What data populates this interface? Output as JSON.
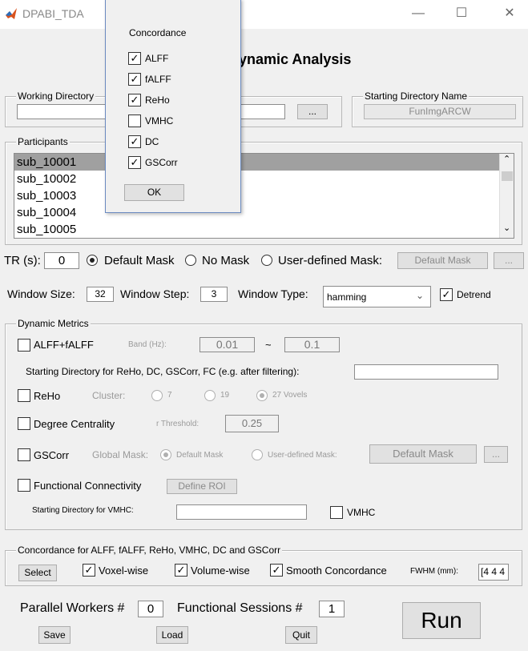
{
  "window": {
    "title": "DPABI_TDA",
    "minimize_glyph": "—",
    "maximize_glyph": "☐",
    "close_glyph": "✕"
  },
  "heading": "ynamic Analysis",
  "working_dir": {
    "legend": "Working Directory",
    "value": "",
    "browse_label": "..."
  },
  "starting_dir": {
    "legend": "Starting Directory Name",
    "value": "FunImgARCW"
  },
  "participants": {
    "legend": "Participants",
    "items": [
      "sub_10001",
      "sub_10002",
      "sub_10003",
      "sub_10004",
      "sub_10005"
    ]
  },
  "mask_row": {
    "tr_label": "TR (s):",
    "tr_value": "0",
    "default_mask": "Default Mask",
    "no_mask": "No Mask",
    "user_mask": "User-defined Mask:",
    "mask_button": "Default Mask",
    "browse_label": "...",
    "selected": "default"
  },
  "window_row": {
    "size_label": "Window Size:",
    "size_value": "32",
    "step_label": "Window Step:",
    "step_value": "3",
    "type_label": "Window Type:",
    "type_value": "hamming",
    "detrend_label": "Detrend",
    "detrend_checked": true
  },
  "dynamic_metrics": {
    "legend": "Dynamic Metrics",
    "alff_label": "ALFF+fALFF",
    "band_label": "Band (Hz):",
    "band_low": "0.01",
    "tilde": "~",
    "band_high": "0.1",
    "starting_dir_label": "Starting Directory for ReHo, DC, GSCorr, FC (e.g. after filtering):",
    "starting_dir_value": "",
    "reho_label": "ReHo",
    "cluster_label": "Cluster:",
    "cluster_7": "7",
    "cluster_19": "19",
    "cluster_27": "27 Vovels",
    "dc_label": "Degree Centrality",
    "r_threshold_label": "r Threshold:",
    "r_threshold_value": "0.25",
    "gscorr_label": "GSCorr",
    "global_mask_label": "Global Mask:",
    "gs_default_mask": "Default Mask",
    "gs_user_mask": "User-defined Mask:",
    "gs_mask_button": "Default Mask",
    "gs_browse_label": "...",
    "fc_label": "Functional Connectivity",
    "define_roi_label": "Define ROI",
    "vmhc_dir_label": "Starting Directory for VMHC:",
    "vmhc_dir_value": "",
    "vmhc_label": "VMHC"
  },
  "concordance_group": {
    "legend": "Concordance for ALFF, fALFF, ReHo, VMHC, DC and GSCorr",
    "select_label": "Select",
    "voxel_wise": "Voxel-wise",
    "volume_wise": "Volume-wise",
    "smooth": "Smooth Concordance",
    "fwhm_label": "FWHM (mm):",
    "fwhm_value": "[4 4 4"
  },
  "bottom": {
    "parallel_label": "Parallel Workers #",
    "parallel_value": "0",
    "sessions_label": "Functional Sessions #",
    "sessions_value": "1",
    "save_label": "Save",
    "load_label": "Load",
    "quit_label": "Quit",
    "run_label": "Run"
  },
  "concordance_popup": {
    "title": "Concordance",
    "items": [
      {
        "label": "ALFF",
        "checked": true
      },
      {
        "label": "fALFF",
        "checked": true
      },
      {
        "label": "ReHo",
        "checked": true
      },
      {
        "label": "VMHC",
        "checked": false
      },
      {
        "label": "DC",
        "checked": true
      },
      {
        "label": "GSCorr",
        "checked": true
      }
    ],
    "ok_label": "OK"
  },
  "colors": {
    "selection": "#a0a0a0",
    "app_icon": "#d9531e",
    "popup_border": "#6a8ac0"
  }
}
